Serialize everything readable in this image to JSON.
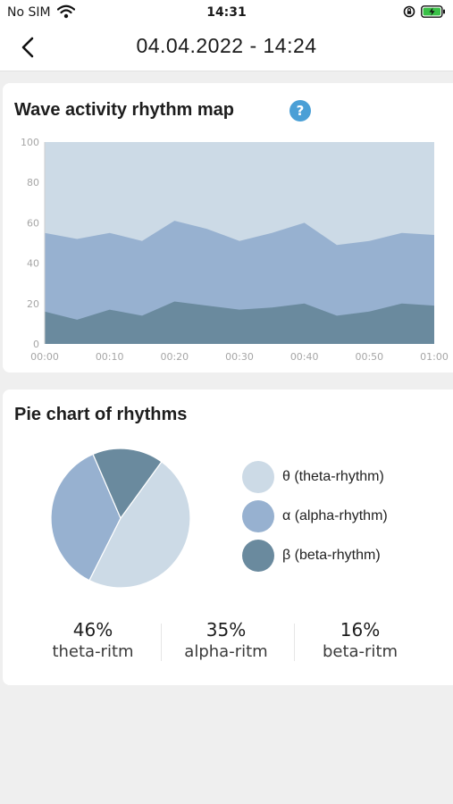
{
  "status_bar": {
    "carrier": "No SIM",
    "time": "14:31",
    "icons": [
      "wifi-icon",
      "rotation-lock-icon",
      "battery-charging-icon"
    ]
  },
  "nav": {
    "title": "04.04.2022 - 14:24",
    "back_icon": "chevron-left-icon"
  },
  "wave_card": {
    "title": "Wave activity rhythm map",
    "help_glyph": "?"
  },
  "pie_card": {
    "title": "Pie chart of rhythms",
    "legend": [
      {
        "label": "θ (theta-rhythm)",
        "color": "#ccdae6"
      },
      {
        "label": "α (alpha-rhythm)",
        "color": "#97b1d0"
      },
      {
        "label": "β (beta-rhythm)",
        "color": "#6a8a9e"
      }
    ],
    "stats": [
      {
        "value": "46%",
        "label": "theta-ritm"
      },
      {
        "value": "35%",
        "label": "alpha-ritm"
      },
      {
        "value": "16%",
        "label": "beta-ritm"
      }
    ]
  },
  "chart_data": [
    {
      "type": "area",
      "stacked": true,
      "x": [
        "00:00",
        "00:05",
        "00:10",
        "00:15",
        "00:20",
        "00:25",
        "00:30",
        "00:35",
        "00:40",
        "00:45",
        "00:50",
        "00:55",
        "01:00"
      ],
      "x_ticks": [
        "00:00",
        "00:10",
        "00:20",
        "00:30",
        "00:40",
        "00:50",
        "01:00"
      ],
      "y_ticks": [
        0,
        20,
        40,
        60,
        80,
        100
      ],
      "ylim": [
        0,
        100
      ],
      "grid": false,
      "colors": [
        "#6a8a9e",
        "#97b1d0",
        "#ccdae6"
      ],
      "series": [
        {
          "values": [
            16,
            12,
            17,
            14,
            21,
            19,
            17,
            18,
            20,
            14,
            16,
            20,
            19
          ]
        },
        {
          "values": [
            39,
            40,
            38,
            37,
            40,
            38,
            34,
            37,
            40,
            35,
            35,
            35,
            35
          ]
        },
        {
          "values": [
            45,
            48,
            45,
            49,
            39,
            43,
            49,
            45,
            40,
            51,
            49,
            45,
            46
          ]
        }
      ]
    },
    {
      "type": "pie",
      "values": [
        46,
        35,
        16
      ],
      "colors": [
        "#ccdae6",
        "#97b1d0",
        "#6a8a9e"
      ]
    }
  ]
}
